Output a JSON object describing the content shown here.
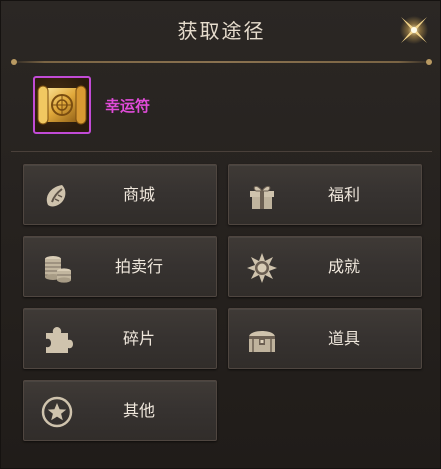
{
  "dialog": {
    "title": "获取途径"
  },
  "item": {
    "name": "幸运符",
    "name_color": "#e04bd9",
    "frame_color": "#c14bd6",
    "icon": "golden-scroll-icon"
  },
  "sources": [
    {
      "label": "商城",
      "icon": "mall-icon"
    },
    {
      "label": "福利",
      "icon": "gift-box-icon"
    },
    {
      "label": "拍卖行",
      "icon": "coins-stack-icon"
    },
    {
      "label": "成就",
      "icon": "achievement-medal-icon"
    },
    {
      "label": "碎片",
      "icon": "puzzle-piece-icon"
    },
    {
      "label": "道具",
      "icon": "treasure-chest-icon"
    },
    {
      "label": "其他",
      "icon": "star-circle-icon"
    }
  ],
  "colors": {
    "text": "#efe7dc",
    "icon_tint": "#cfc3ad",
    "panel": "#2b2724"
  }
}
